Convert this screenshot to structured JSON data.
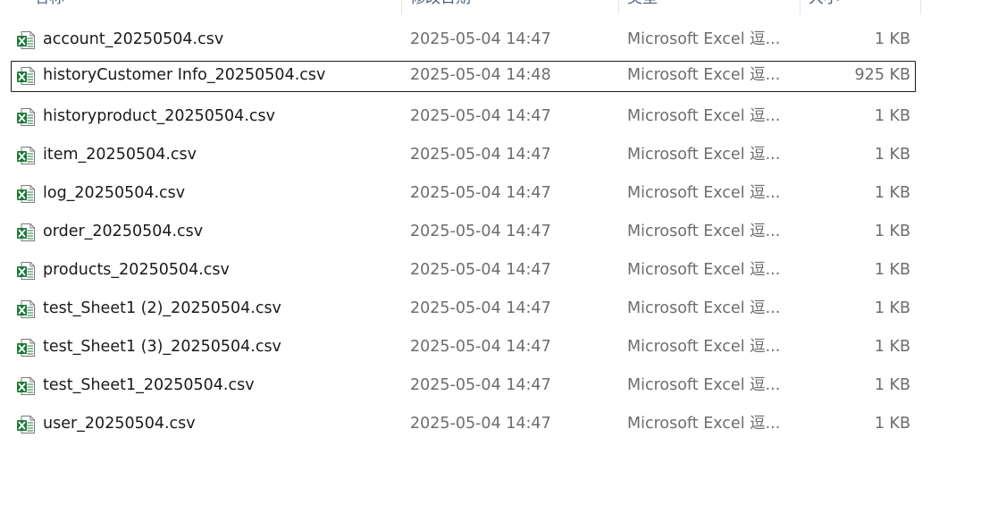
{
  "columns": {
    "name": "名称",
    "date": "修改日期",
    "type": "类型",
    "size": "大小"
  },
  "icon": "excel-csv-file-icon",
  "accent_color": "#1d7a3a",
  "files": [
    {
      "name": "account_20250504.csv",
      "date": "2025-05-04 14:47",
      "type": "Microsoft Excel 逗...",
      "size": "1 KB"
    },
    {
      "name": "historyCustomer Info_20250504.csv",
      "date": "2025-05-04 14:48",
      "type": "Microsoft Excel 逗...",
      "size": "925 KB",
      "focused": true
    },
    {
      "name": "historyproduct_20250504.csv",
      "date": "2025-05-04 14:47",
      "type": "Microsoft Excel 逗...",
      "size": "1 KB"
    },
    {
      "name": "item_20250504.csv",
      "date": "2025-05-04 14:47",
      "type": "Microsoft Excel 逗...",
      "size": "1 KB"
    },
    {
      "name": "log_20250504.csv",
      "date": "2025-05-04 14:47",
      "type": "Microsoft Excel 逗...",
      "size": "1 KB"
    },
    {
      "name": "order_20250504.csv",
      "date": "2025-05-04 14:47",
      "type": "Microsoft Excel 逗...",
      "size": "1 KB"
    },
    {
      "name": "products_20250504.csv",
      "date": "2025-05-04 14:47",
      "type": "Microsoft Excel 逗...",
      "size": "1 KB"
    },
    {
      "name": "test_Sheet1 (2)_20250504.csv",
      "date": "2025-05-04 14:47",
      "type": "Microsoft Excel 逗...",
      "size": "1 KB"
    },
    {
      "name": "test_Sheet1 (3)_20250504.csv",
      "date": "2025-05-04 14:47",
      "type": "Microsoft Excel 逗...",
      "size": "1 KB"
    },
    {
      "name": "test_Sheet1_20250504.csv",
      "date": "2025-05-04 14:47",
      "type": "Microsoft Excel 逗...",
      "size": "1 KB"
    },
    {
      "name": "user_20250504.csv",
      "date": "2025-05-04 14:47",
      "type": "Microsoft Excel 逗...",
      "size": "1 KB"
    }
  ]
}
